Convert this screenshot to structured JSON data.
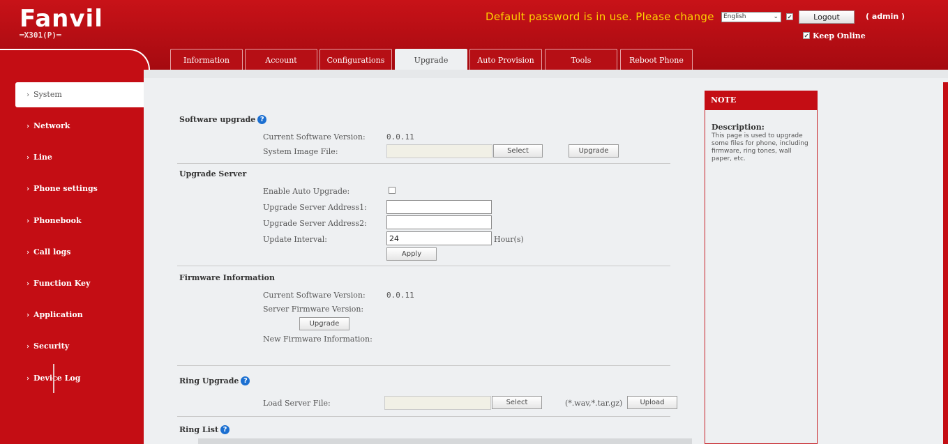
{
  "header": {
    "logo_main": "Fanvil",
    "logo_sub": "X301(P)",
    "warning": "Default password is in use. Please change",
    "language_selected": "English",
    "logout_label": "Logout",
    "user": "( admin )",
    "keep_online": "Keep Online"
  },
  "tabs": [
    {
      "label": "Information"
    },
    {
      "label": "Account"
    },
    {
      "label": "Configurations"
    },
    {
      "label": "Upgrade"
    },
    {
      "label": "Auto Provision"
    },
    {
      "label": "Tools"
    },
    {
      "label": "Reboot Phone"
    }
  ],
  "sidebar": {
    "items": [
      {
        "label": "System"
      },
      {
        "label": "Network"
      },
      {
        "label": "Line"
      },
      {
        "label": "Phone settings"
      },
      {
        "label": "Phonebook"
      },
      {
        "label": "Call logs"
      },
      {
        "label": "Function Key"
      },
      {
        "label": "Application"
      },
      {
        "label": "Security"
      },
      {
        "label": "Device Log"
      }
    ]
  },
  "software_upgrade": {
    "title": "Software upgrade",
    "current_version_label": "Current Software Version:",
    "current_version": "0.0.11",
    "image_file_label": "System Image File:",
    "select_label": "Select",
    "upgrade_label": "Upgrade"
  },
  "upgrade_server": {
    "title": "Upgrade Server",
    "enable_auto_label": "Enable Auto Upgrade:",
    "address1_label": "Upgrade Server Address1:",
    "address1_value": "",
    "address2_label": "Upgrade Server Address2:",
    "address2_value": "",
    "interval_label": "Update Interval:",
    "interval_value": "24",
    "interval_unit": "Hour(s)",
    "apply_label": "Apply"
  },
  "firmware_info": {
    "title": "Firmware Information",
    "current_version_label": "Current Software Version:",
    "current_version": "0.0.11",
    "server_version_label": "Server Firmware Version:",
    "upgrade_label": "Upgrade",
    "new_info_label": "New Firmware Information:"
  },
  "ring_upgrade": {
    "title": "Ring Upgrade",
    "load_label": "Load Server File:",
    "select_label": "Select",
    "formats": "(*.wav,*.tar.gz)",
    "upload_label": "Upload"
  },
  "ring_list": {
    "title": "Ring List"
  },
  "note": {
    "title": "NOTE",
    "desc_title": "Description:",
    "desc_text": "This page is used to upgrade some files for phone, including firmware, ring tones, wall paper, etc."
  },
  "colors": {
    "brand_red": "#c40d14",
    "warning_yellow": "#ffd400",
    "help_blue": "#1b6fd1"
  }
}
